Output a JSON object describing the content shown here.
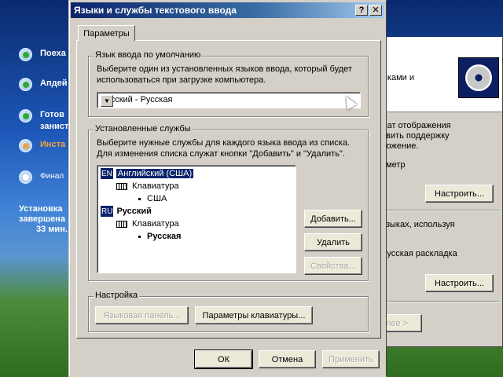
{
  "setup": {
    "steps": [
      {
        "label": "Поеха",
        "state": "done"
      },
      {
        "label": "Апдей",
        "state": "done"
      },
      {
        "label": "Готов\nзанист",
        "state": "done"
      },
      {
        "label": "Инста",
        "state": "active"
      },
      {
        "label": "Финал",
        "state": "pending"
      }
    ],
    "eta_line1": "Установка",
    "eta_line2": "завершена",
    "eta_line3": "33 мин."
  },
  "back_window": {
    "header_text": "ыками и",
    "text1_line1": "мат отображения",
    "text1_line2": "авить поддержку",
    "text1_line3": "ложение.",
    "param_label": "аметр",
    "configure_1": "Настроить...",
    "text2": "языках, используя",
    "layout_label": "Русская раскладка",
    "configure_2": "Настроить...",
    "next_fragment": "алее >"
  },
  "dialog": {
    "title": "Языки и службы текстового ввода",
    "help_glyph": "?",
    "close_glyph": "✕",
    "tab_label": "Параметры",
    "default_group": {
      "title": "Язык ввода по умолчанию",
      "description_line1": "Выберите один из установленных языков ввода, который будет",
      "description_line2": "использоваться при загрузке компьютера.",
      "selected_value": "Русский - Русская"
    },
    "services_group": {
      "title": "Установленные службы",
      "description_line1": "Выберите нужные службы для каждого языка ввода из списка.",
      "description_line2": "Для изменения списка служат кнопки \"Добавить\" и \"Удалить\".",
      "tree": {
        "en_tag": "EN",
        "en_label": "Английский (США)",
        "en_keyboard": "Клавиатура",
        "en_layout": "США",
        "ru_tag": "RU",
        "ru_label": "Русский",
        "ru_keyboard": "Клавиатура",
        "ru_layout": "Русская"
      },
      "add_button": "Добавить...",
      "remove_button": "Удалить",
      "properties_button": "Свойства..."
    },
    "settings_group": {
      "title": "Настройка",
      "language_bar_button": "Языковая панель...",
      "key_settings_button": "Параметры клавиатуры..."
    },
    "ok_button": "ОК",
    "cancel_button": "Отмена",
    "apply_button": "Применить"
  }
}
